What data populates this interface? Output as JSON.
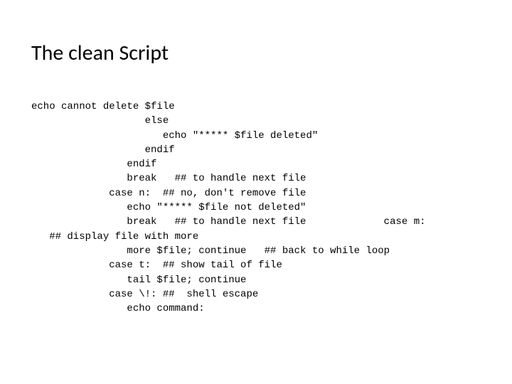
{
  "title": "The clean Script",
  "code": "echo cannot delete $file\n                   else\n                      echo \"***** $file deleted\"\n                   endif\n                endif\n                break   ## to handle next file\n             case n:  ## no, don't remove file\n                echo \"***** $file not deleted\"\n                break   ## to handle next file             case m:\n   ## display file with more\n                more $file; continue   ## back to while loop\n             case t:  ## show tail of file\n                tail $file; continue\n             case \\!: ##  shell escape\n                echo command:"
}
